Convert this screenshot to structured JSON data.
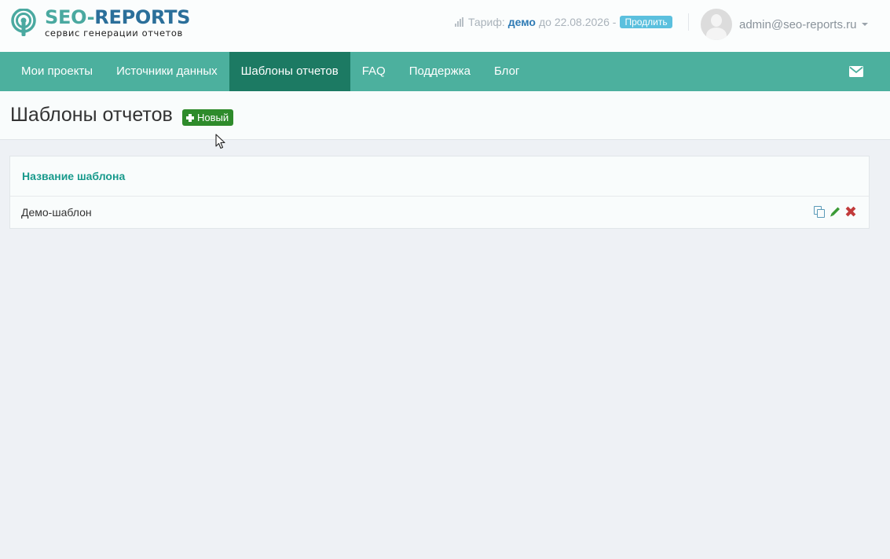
{
  "brand": {
    "title_part1": "SEO-",
    "title_part2": "REPORTS",
    "subtitle": "сервис генерации отчетов",
    "colors": {
      "teal": "#4aa9a0",
      "blue": "#2b6f9a"
    }
  },
  "tariff": {
    "label": "Тариф:",
    "plan": "демо",
    "until_label": "до",
    "date": "22.08.2026 -",
    "renew_button": "Продлить",
    "icon": "signal-icon"
  },
  "user": {
    "email": "admin@seo-reports.ru",
    "avatar_icon": "avatar-placeholder",
    "dropdown_icon": "caret-down-icon"
  },
  "nav": {
    "items": [
      {
        "label": "Мои проекты",
        "active": false
      },
      {
        "label": "Источники данных",
        "active": false
      },
      {
        "label": "Шаблоны отчетов",
        "active": true
      },
      {
        "label": "FAQ",
        "active": false
      },
      {
        "label": "Поддержка",
        "active": false
      },
      {
        "label": "Блог",
        "active": false
      }
    ],
    "mail_icon": "envelope-icon",
    "colors": {
      "bar": "#4cb09e",
      "active": "#1c7a63"
    }
  },
  "page": {
    "title": "Шаблоны отчетов",
    "new_button": "Новый",
    "new_button_color": "#2e8b2b"
  },
  "table": {
    "header": "Название шаблона",
    "rows": [
      {
        "name": "Демо-шаблон",
        "actions": [
          "copy-icon",
          "edit-icon",
          "delete-icon"
        ]
      }
    ]
  }
}
